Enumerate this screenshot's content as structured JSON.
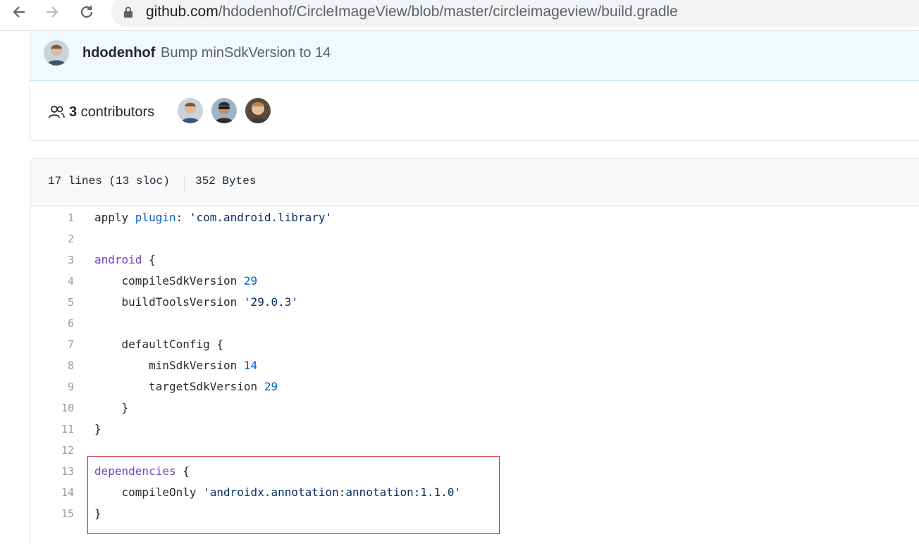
{
  "browser": {
    "url_host": "github.com",
    "url_path": "/hdodenhof/CircleImageView/blob/master/circleimageview/build.gradle"
  },
  "commit": {
    "author": "hdodenhof",
    "message": "Bump minSdkVersion to 14"
  },
  "contributors": {
    "count": "3",
    "label": " contributors"
  },
  "file": {
    "lines_info": "17 lines (13 sloc)",
    "size": "352 Bytes"
  },
  "code_lines": [
    {
      "n": "1",
      "parts": [
        [
          "",
          "apply "
        ],
        [
          "ent",
          "plugin"
        ],
        [
          "",
          ": "
        ],
        [
          "str",
          "'com.android.library'"
        ]
      ]
    },
    {
      "n": "2",
      "parts": []
    },
    {
      "n": "3",
      "parts": [
        [
          "kw",
          "android"
        ],
        [
          "",
          " {"
        ]
      ]
    },
    {
      "n": "4",
      "parts": [
        [
          "",
          "    compileSdkVersion "
        ],
        [
          "num",
          "29"
        ]
      ]
    },
    {
      "n": "5",
      "parts": [
        [
          "",
          "    buildToolsVersion "
        ],
        [
          "str",
          "'29.0.3'"
        ]
      ]
    },
    {
      "n": "6",
      "parts": []
    },
    {
      "n": "7",
      "parts": [
        [
          "",
          "    defaultConfig {"
        ]
      ]
    },
    {
      "n": "8",
      "parts": [
        [
          "",
          "        minSdkVersion "
        ],
        [
          "num",
          "14"
        ]
      ]
    },
    {
      "n": "9",
      "parts": [
        [
          "",
          "        targetSdkVersion "
        ],
        [
          "num",
          "29"
        ]
      ]
    },
    {
      "n": "10",
      "parts": [
        [
          "",
          "    }"
        ]
      ]
    },
    {
      "n": "11",
      "parts": [
        [
          "",
          "}"
        ]
      ]
    },
    {
      "n": "12",
      "parts": []
    },
    {
      "n": "13",
      "parts": [
        [
          "kw",
          "dependencies"
        ],
        [
          "",
          " {"
        ]
      ]
    },
    {
      "n": "14",
      "parts": [
        [
          "",
          "    compileOnly "
        ],
        [
          "str",
          "'androidx.annotation:annotation:1.1.0'"
        ]
      ]
    },
    {
      "n": "15",
      "parts": [
        [
          "",
          "}"
        ]
      ]
    }
  ]
}
